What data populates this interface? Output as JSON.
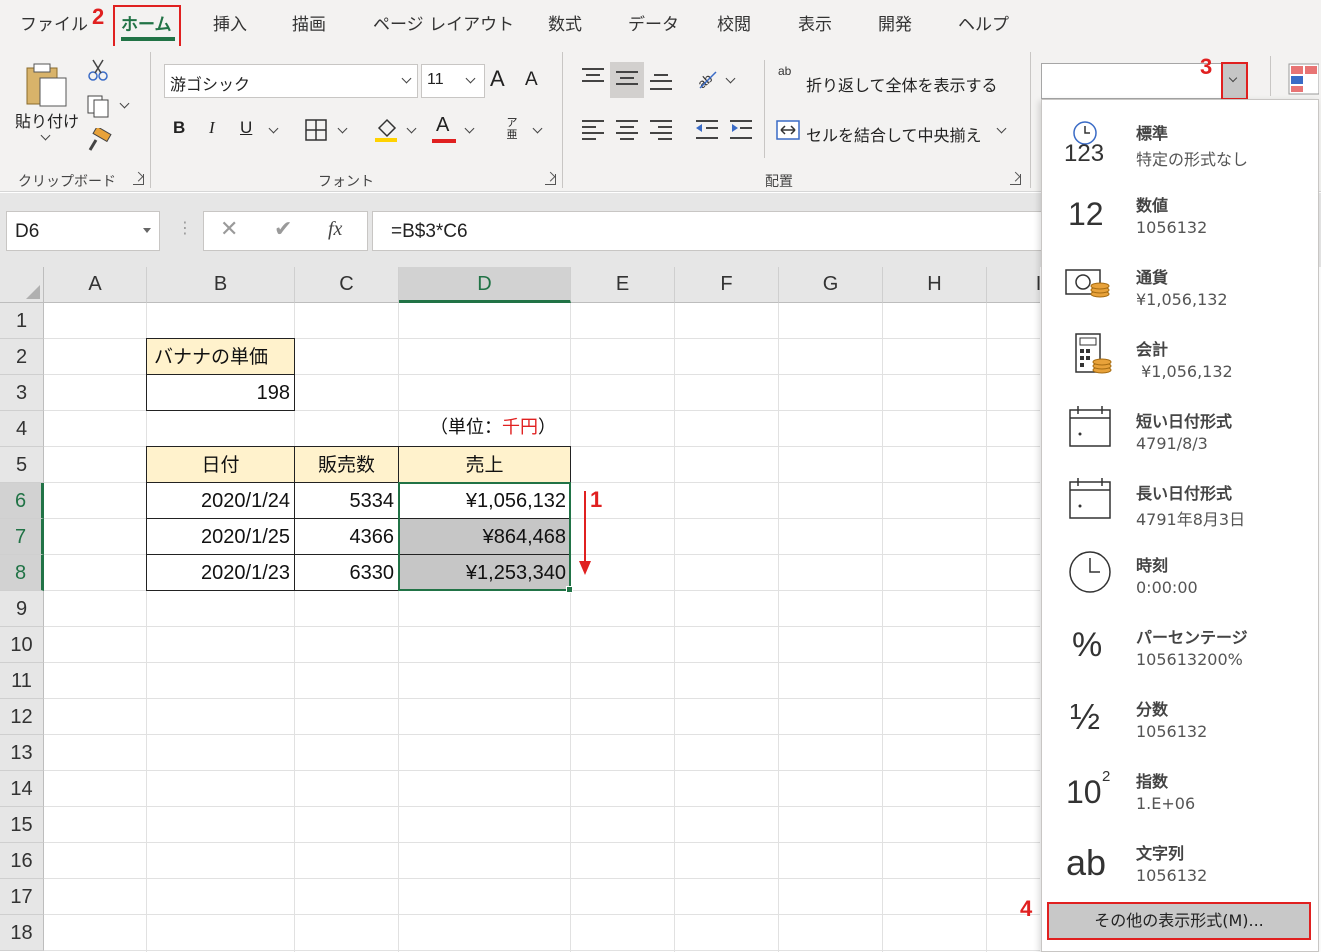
{
  "menu": {
    "tabs": [
      "ファイル",
      "ホーム",
      "挿入",
      "描画",
      "ページ レイアウト",
      "数式",
      "データ",
      "校閲",
      "表示",
      "開発",
      "ヘルプ"
    ],
    "active_tab": "ホーム"
  },
  "steps": {
    "s1": "1",
    "s2": "2",
    "s3": "3",
    "s4": "4"
  },
  "ribbon": {
    "clipboard": {
      "paste_label": "貼り付け",
      "group_label": "クリップボード"
    },
    "font": {
      "font_name": "游ゴシック",
      "font_size": "11",
      "grow": "A",
      "shrink": "A",
      "bold": "B",
      "italic": "I",
      "underline": "U",
      "font_color_letter": "A",
      "phonetic": "ア亜",
      "group_label": "フォント"
    },
    "alignment": {
      "wrap_text": "折り返して全体を表示する",
      "merge_center": "セルを結合して中央揃え",
      "group_label": "配置",
      "wrap_icon_text": "ab"
    }
  },
  "formula_bar": {
    "name_box": "D6",
    "formula": "=B$3*C6",
    "fx": "fx"
  },
  "grid": {
    "columns": [
      "A",
      "B",
      "C",
      "D",
      "E",
      "F",
      "G",
      "H",
      "I"
    ],
    "rows": [
      "1",
      "2",
      "3",
      "4",
      "5",
      "6",
      "7",
      "8",
      "9",
      "10",
      "11",
      "12",
      "13",
      "14",
      "15",
      "16",
      "17",
      "18"
    ],
    "unit_price_label": "バナナの単価",
    "unit_price_value": "198",
    "unit_note_prefix": "（単位：",
    "unit_note_red": "千円",
    "unit_note_suffix": "）",
    "table_headers": [
      "日付",
      "販売数",
      "売上"
    ],
    "table_rows": [
      {
        "date": "2020/1/24",
        "qty": "5334",
        "sales": "¥1,056,132"
      },
      {
        "date": "2020/1/25",
        "qty": "4366",
        "sales": "¥864,468"
      },
      {
        "date": "2020/1/23",
        "qty": "6330",
        "sales": "¥1,253,340"
      }
    ],
    "selected_cell": "D6"
  },
  "number_format": {
    "items": [
      {
        "icon": "clock-123-icon",
        "icon_text": "123",
        "title": "標準",
        "sample": "特定の形式なし"
      },
      {
        "icon": "number-12-icon",
        "icon_text": "12",
        "title": "数値",
        "sample": "1056132"
      },
      {
        "icon": "currency-icon",
        "icon_text": "",
        "title": "通貨",
        "sample": "¥1,056,132"
      },
      {
        "icon": "calculator-icon",
        "icon_text": "",
        "title": "会計",
        "sample": " ¥1,056,132"
      },
      {
        "icon": "short-date-icon",
        "icon_text": "",
        "title": "短い日付形式",
        "sample": "4791/8/3"
      },
      {
        "icon": "long-date-icon",
        "icon_text": "",
        "title": "長い日付形式",
        "sample": "4791年8月3日"
      },
      {
        "icon": "clock-icon",
        "icon_text": "",
        "title": "時刻",
        "sample": "0:00:00"
      },
      {
        "icon": "percent-icon",
        "icon_text": "%",
        "title": "パーセンテージ",
        "sample": "105613200%"
      },
      {
        "icon": "fraction-icon",
        "icon_text": "½",
        "title": "分数",
        "sample": "1056132"
      },
      {
        "icon": "exponent-icon",
        "icon_text": "10",
        "icon_sup": "2",
        "title": "指数",
        "sample": "1.E+06"
      },
      {
        "icon": "text-ab-icon",
        "icon_text": "ab",
        "title": "文字列",
        "sample": "1056132"
      }
    ],
    "more_formats": "その他の表示形式(M)..."
  },
  "colors": {
    "accent_green": "#217346",
    "annotation_red": "#e02020",
    "header_fill": "#fff2cc",
    "selection_fill": "#c6c6c6"
  }
}
